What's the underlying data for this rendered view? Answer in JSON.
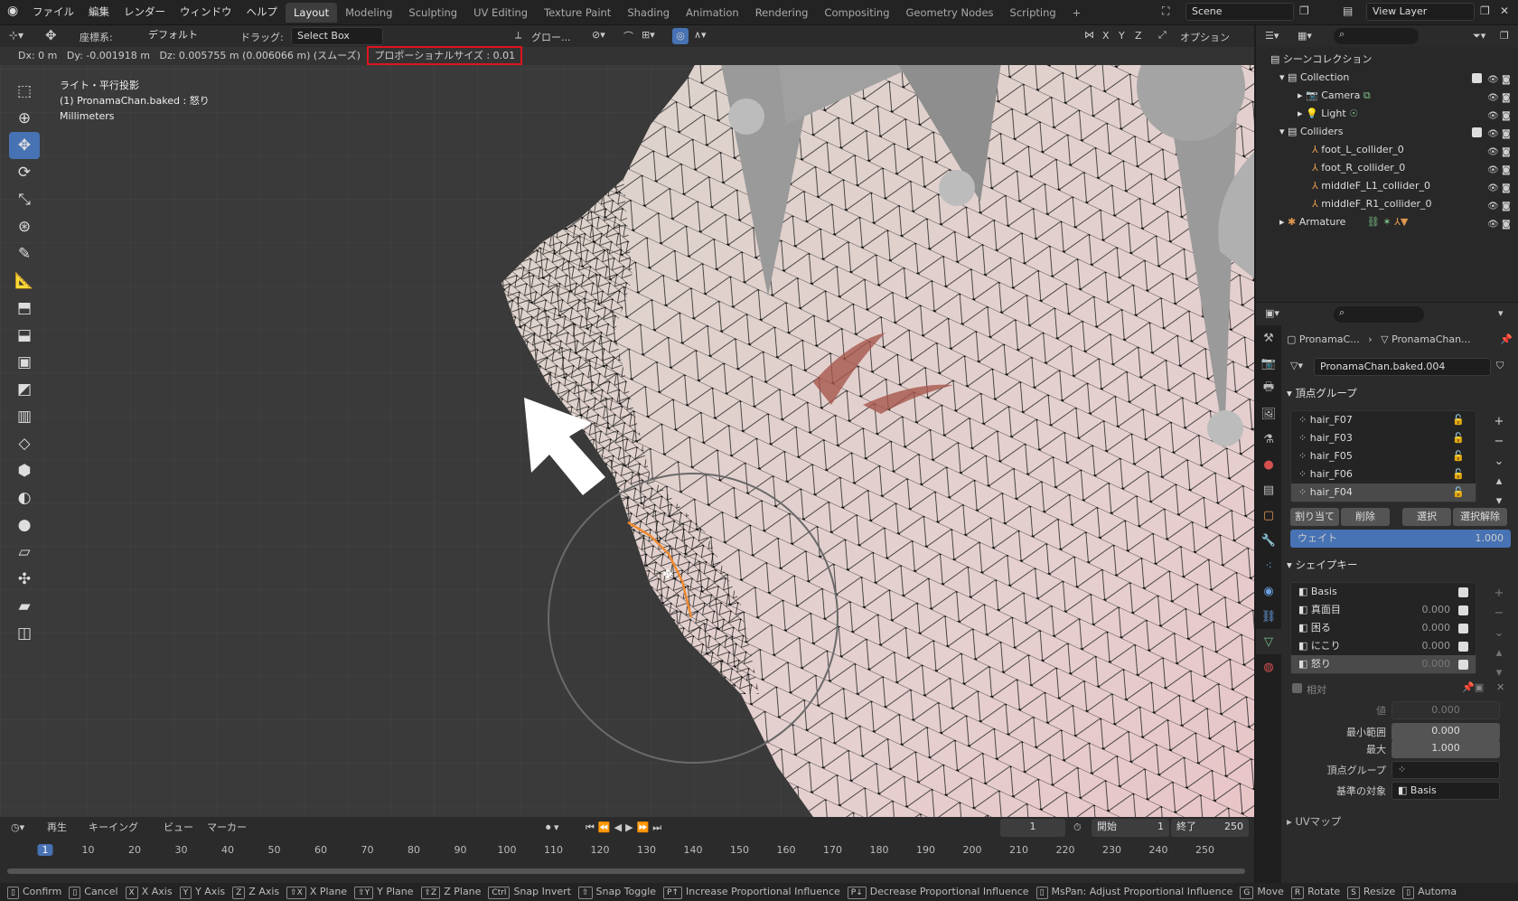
{
  "menu": {
    "items": [
      "ファイル",
      "編集",
      "レンダー",
      "ウィンドウ",
      "ヘルプ"
    ]
  },
  "workspaces": {
    "tabs": [
      "Layout",
      "Modeling",
      "Sculpting",
      "UV Editing",
      "Texture Paint",
      "Shading",
      "Animation",
      "Rendering",
      "Compositing",
      "Geometry Nodes",
      "Scripting"
    ],
    "active": "Layout"
  },
  "scene": {
    "name": "Scene",
    "view_layer": "View Layer"
  },
  "viewport_header": {
    "orientation_label": "座標系:",
    "orientation_value": "デフォルト",
    "drag_label": "ドラッグ:",
    "drag_value": "Select Box",
    "pivot_value": "グロー...",
    "options_label": "オプション",
    "axes": [
      "X",
      "Y",
      "Z"
    ]
  },
  "transform_info": {
    "dx": "Dx: 0 m",
    "dy": "Dy: -0.001918 m",
    "dz": "Dz: 0.005755 m (0.006066 m) (スムーズ)",
    "proportional": "プロポーショナルサイズ : 0.01"
  },
  "overlay_text": {
    "view": "ライト・平行投影",
    "object": "(1) PronamaChan.baked : 怒り",
    "units": "Millimeters"
  },
  "outliner": {
    "title": "シーンコレクション",
    "items": [
      {
        "name": "Collection",
        "depth": 1
      },
      {
        "name": "Camera",
        "depth": 2
      },
      {
        "name": "Light",
        "depth": 2
      },
      {
        "name": "Colliders",
        "depth": 1
      },
      {
        "name": "foot_L_collider_0",
        "depth": 2
      },
      {
        "name": "foot_R_collider_0",
        "depth": 2
      },
      {
        "name": "middleF_L1_collider_0",
        "depth": 2
      },
      {
        "name": "middleF_R1_collider_0",
        "depth": 2
      },
      {
        "name": "Armature",
        "depth": 1
      }
    ]
  },
  "properties": {
    "breadcrumb_object": "PronamaC...",
    "breadcrumb_data": "PronamaChan...",
    "mesh_name": "PronamaChan.baked.004",
    "vertex_groups_title": "頂点グループ",
    "vertex_groups": [
      "hair_F07",
      "hair_F03",
      "hair_F05",
      "hair_F06",
      "hair_F04"
    ],
    "vg_buttons": [
      "割り当て",
      "削除",
      "選択",
      "選択解除"
    ],
    "weight_label": "ウェイト",
    "weight_value": "1.000",
    "shape_keys_title": "シェイプキー",
    "shape_keys": [
      {
        "name": "Basis",
        "value": ""
      },
      {
        "name": "真面目",
        "value": "0.000"
      },
      {
        "name": "困る",
        "value": "0.000"
      },
      {
        "name": "にこり",
        "value": "0.000"
      },
      {
        "name": "怒り",
        "value": "0.000"
      }
    ],
    "relative_label": "相対",
    "value_label": "値",
    "value_value": "0.000",
    "min_label": "最小範囲",
    "min_value": "0.000",
    "max_label": "最大",
    "max_value": "1.000",
    "vgroup_label": "頂点グループ",
    "relative_to_label": "基準の対象",
    "relative_to_value": "Basis",
    "uv_title": "UVマップ"
  },
  "timeline": {
    "menus": [
      "再生",
      "キーイング",
      "ビュー",
      "マーカー"
    ],
    "current_frame": "1",
    "start_label": "開始",
    "start_value": "1",
    "end_label": "終了",
    "end_value": "250",
    "ticks": [
      "1",
      "10",
      "20",
      "30",
      "40",
      "50",
      "60",
      "70",
      "80",
      "90",
      "100",
      "110",
      "120",
      "130",
      "140",
      "150",
      "160",
      "170",
      "180",
      "190",
      "200",
      "210",
      "220",
      "230",
      "240",
      "250"
    ]
  },
  "statusbar": {
    "items": [
      {
        "key": "",
        "label": "Confirm"
      },
      {
        "key": "",
        "label": "Cancel"
      },
      {
        "key": "X",
        "label": "X Axis"
      },
      {
        "key": "Y",
        "label": "Y Axis"
      },
      {
        "key": "Z",
        "label": "Z Axis"
      },
      {
        "key": "⇧X",
        "label": "X Plane"
      },
      {
        "key": "⇧Y",
        "label": "Y Plane"
      },
      {
        "key": "⇧Z",
        "label": "Z Plane"
      },
      {
        "key": "Ctrl",
        "label": "Snap Invert"
      },
      {
        "key": "⇧",
        "label": "Snap Toggle"
      },
      {
        "key": "P↑",
        "label": "Increase Proportional Influence"
      },
      {
        "key": "P↓",
        "label": "Decrease Proportional Influence"
      },
      {
        "key": "",
        "label": "MsPan: Adjust Proportional Influence"
      },
      {
        "key": "G",
        "label": "Move"
      },
      {
        "key": "R",
        "label": "Rotate"
      },
      {
        "key": "S",
        "label": "Resize"
      },
      {
        "key": "",
        "label": "Automa"
      }
    ]
  },
  "colors": {
    "accent": "#4772b3",
    "highlight_box": "#e0141e",
    "selection_orange": "#f08a30"
  }
}
